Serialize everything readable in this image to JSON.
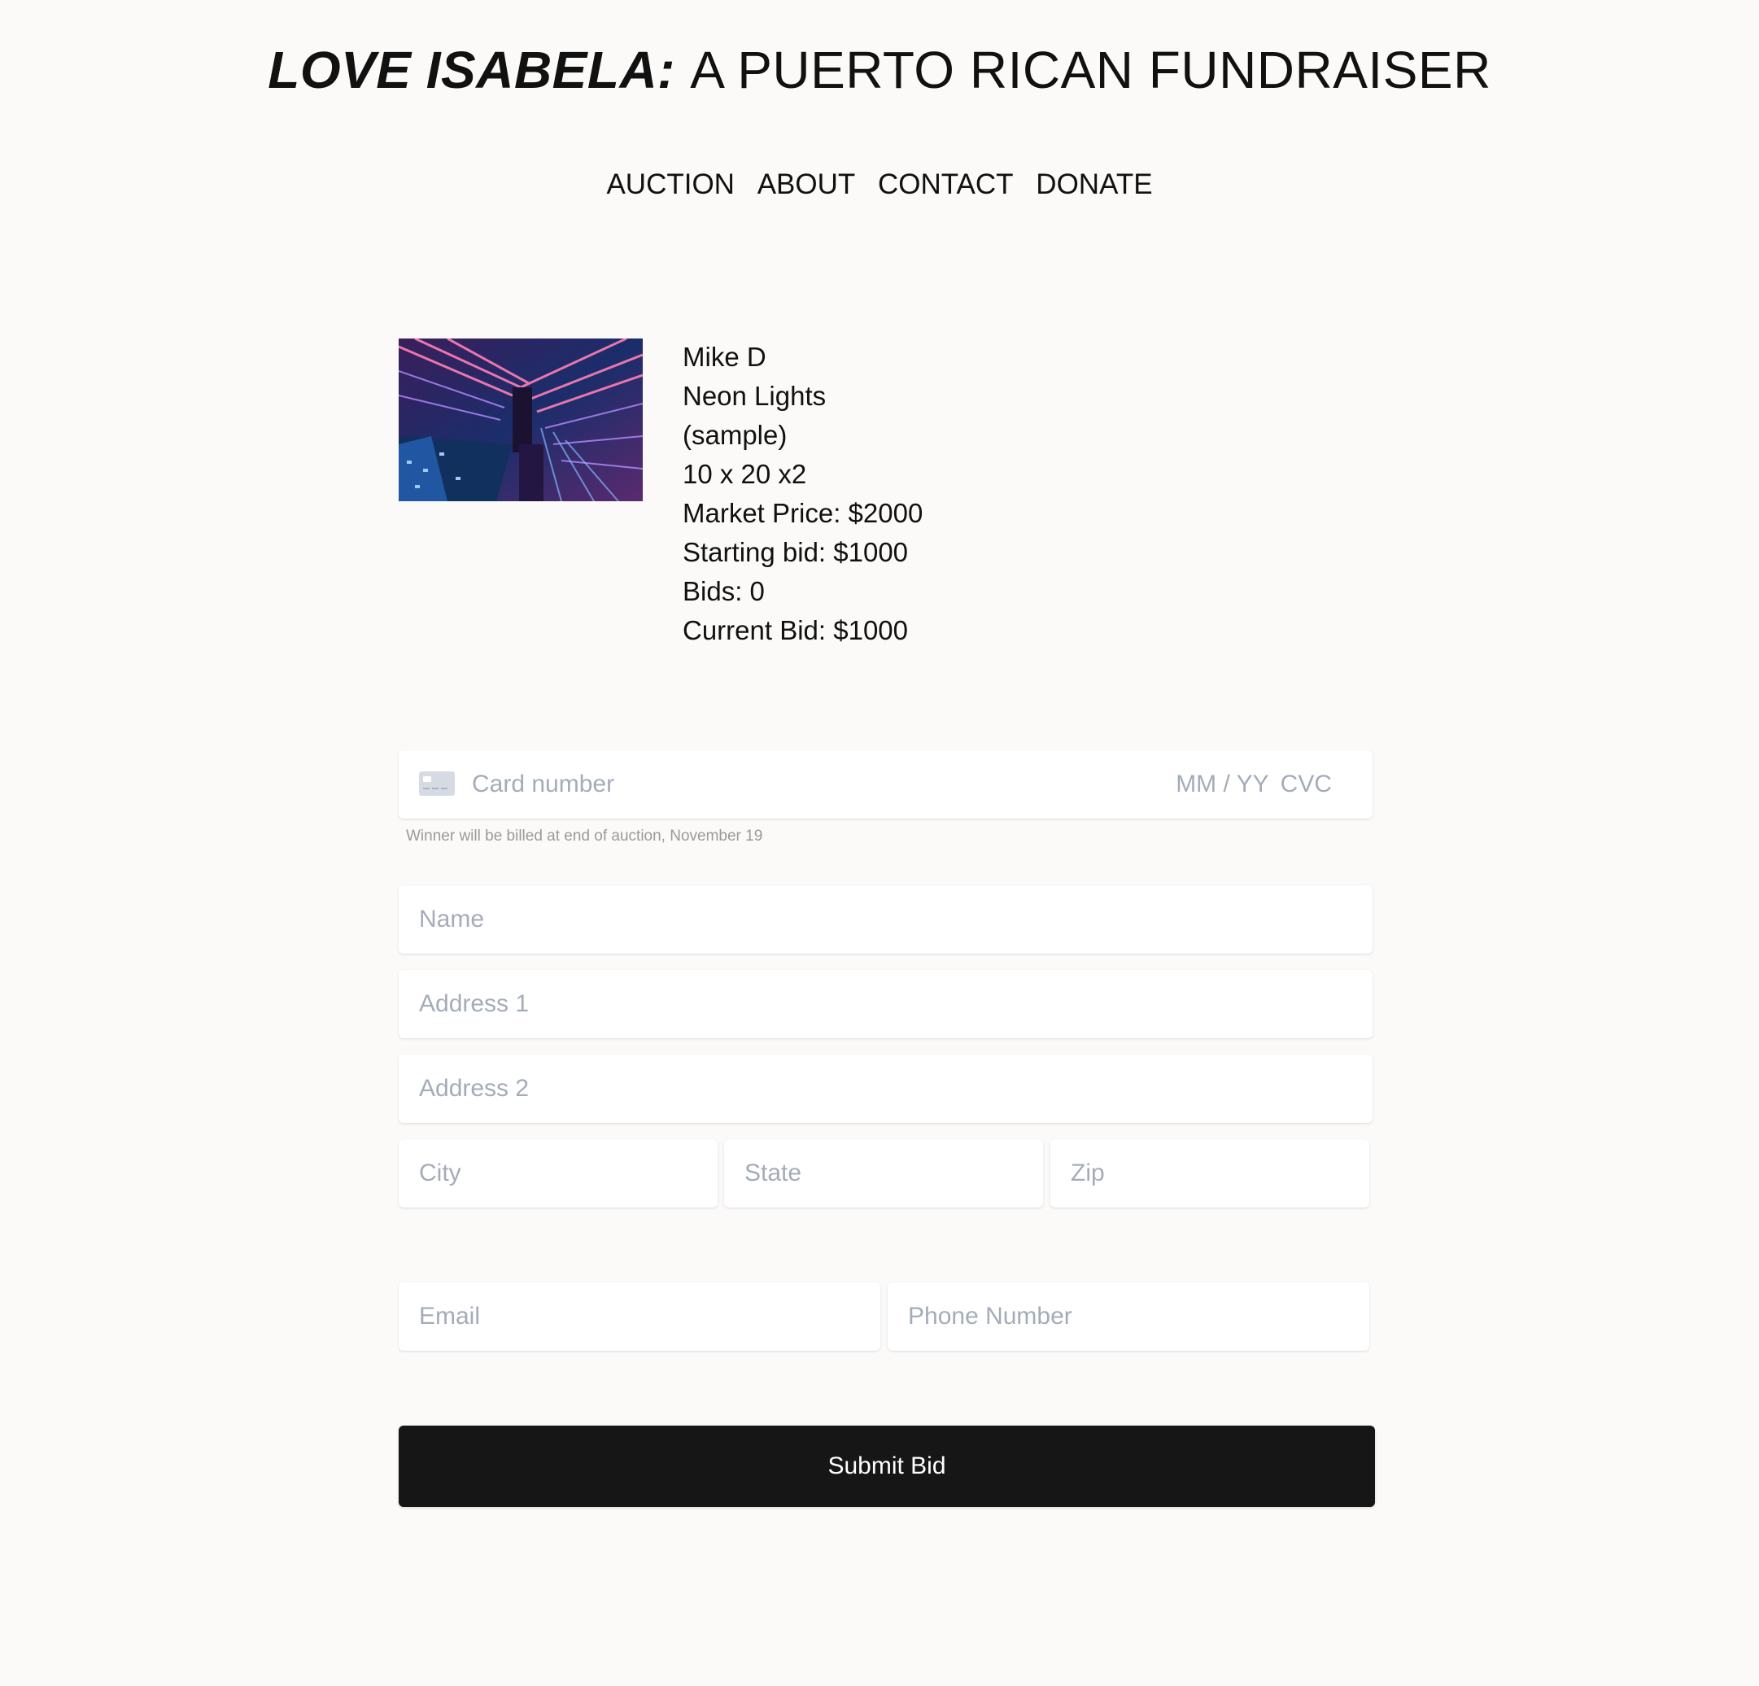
{
  "header": {
    "brand": "LOVE ISABELA:",
    "subtitle": "A PUERTO RICAN FUNDRAISER"
  },
  "nav": {
    "items": [
      {
        "label": "AUCTION"
      },
      {
        "label": "ABOUT"
      },
      {
        "label": "CONTACT"
      },
      {
        "label": "DONATE"
      }
    ]
  },
  "item": {
    "image_icon": "neon-lights-photo",
    "artist": "Mike D",
    "title": "Neon Lights",
    "note": "(sample)",
    "size": "10 x 20 x2",
    "market_price": "Market Price: $2000",
    "starting_bid": "Starting bid: $1000",
    "bids": "Bids: 0",
    "current_bid": "Current Bid: $1000"
  },
  "form": {
    "card": {
      "icon": "credit-card-icon",
      "number_placeholder": "Card number",
      "expiry_placeholder": "MM / YY",
      "cvc_placeholder": "CVC"
    },
    "billing_note": "Winner will be billed at end of auction, November 19",
    "name_placeholder": "Name",
    "address1_placeholder": "Address 1",
    "address2_placeholder": "Address 2",
    "city_placeholder": "City",
    "state_placeholder": "State",
    "zip_placeholder": "Zip",
    "email_placeholder": "Email",
    "phone_placeholder": "Phone Number",
    "submit_label": "Submit Bid"
  },
  "colors": {
    "background": "#fbfaf9",
    "button": "#161616",
    "placeholder": "#a4acb9"
  }
}
